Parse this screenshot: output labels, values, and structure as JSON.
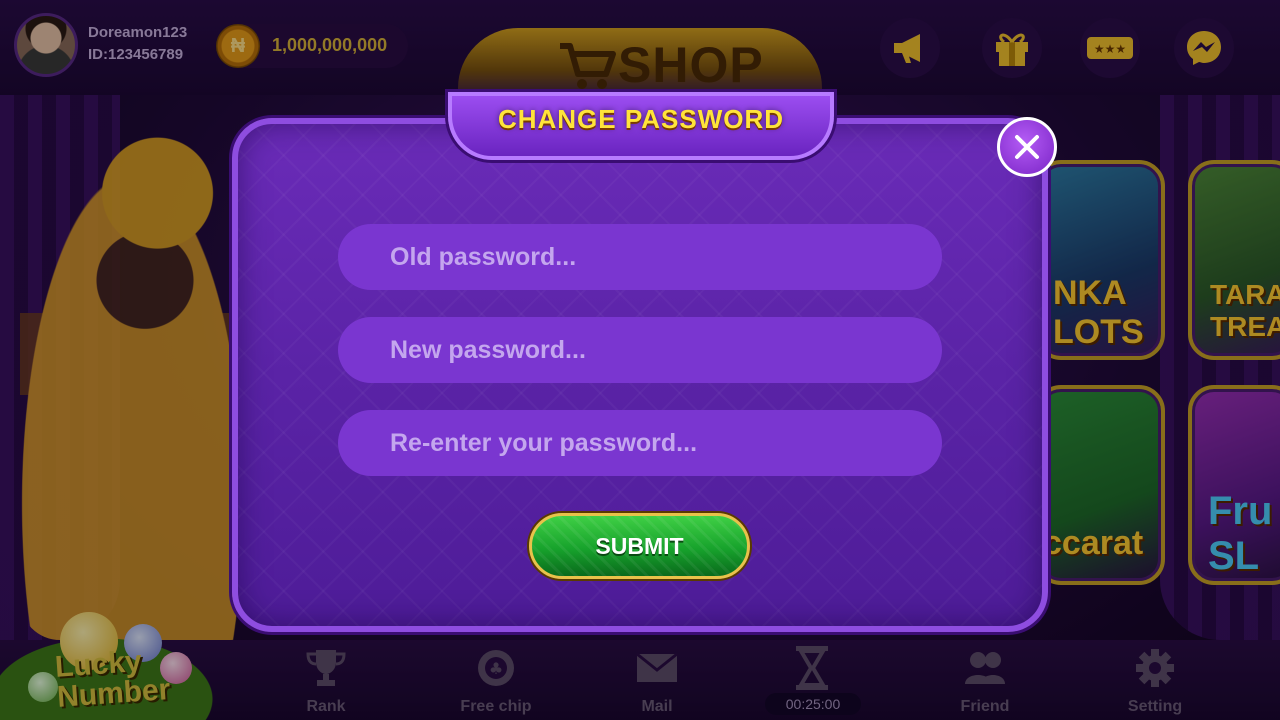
{
  "user": {
    "name": "Doreamon123",
    "id": "ID:123456789",
    "balance": "1,000,000,000",
    "coin_symbol": "₦"
  },
  "header": {
    "shop_label": "SHOP",
    "icons": [
      "megaphone-icon",
      "gift-icon",
      "tickets-icon",
      "messenger-icon"
    ]
  },
  "modal": {
    "title": "CHANGE PASSWORD",
    "fields": {
      "old_placeholder": "Old password...",
      "new_placeholder": "New password...",
      "reenter_placeholder": "Re-enter your password..."
    },
    "submit_label": "SUBMIT"
  },
  "background_games": {
    "tile_1": "NKA\nLOTS",
    "tile_2": "TARA\nTREA",
    "tile_3": "ccarat",
    "tile_4": "Fru\nSL"
  },
  "bottom_nav": {
    "lucky_number": "Lucky Number",
    "items": [
      {
        "label": "Rank",
        "icon": "trophy-icon"
      },
      {
        "label": "Free chip",
        "icon": "chip-icon"
      },
      {
        "label": "Mail",
        "icon": "mail-icon"
      },
      {
        "label": "Friend",
        "icon": "friends-icon"
      },
      {
        "label": "Setting",
        "icon": "gear-icon"
      }
    ],
    "timer": "00:25:00"
  },
  "colors": {
    "modal_purple": "#5a23a6",
    "title_yellow": "#ffe43a",
    "submit_green": "#17a22c",
    "field_purple": "#7a36d0"
  }
}
